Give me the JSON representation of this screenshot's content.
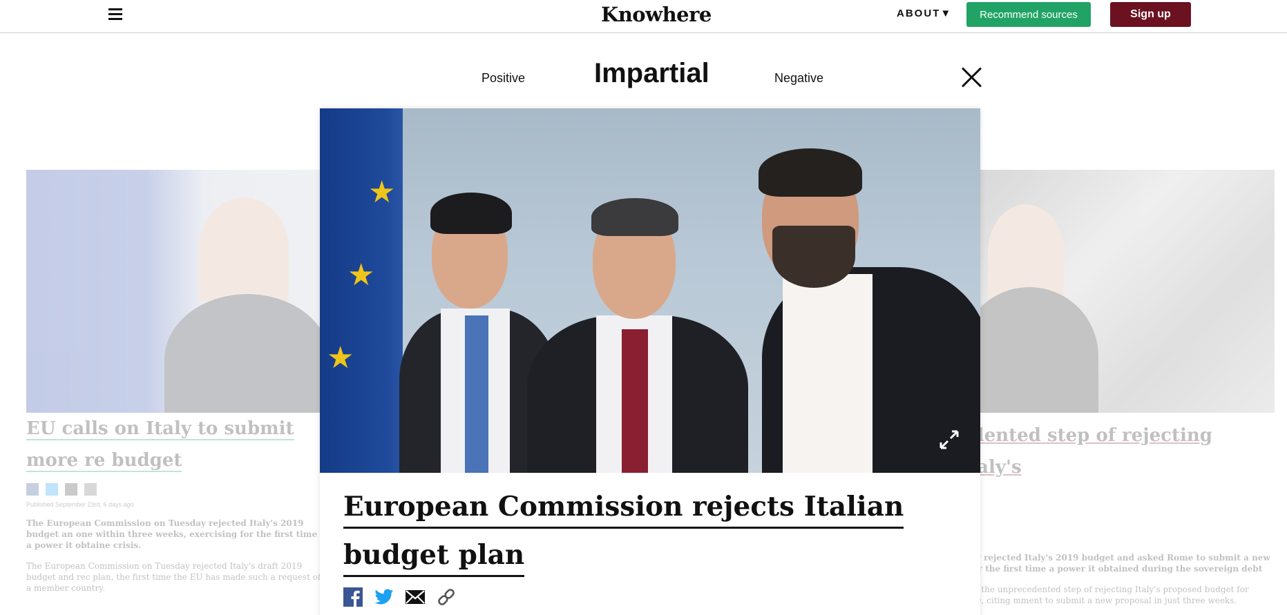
{
  "nav": {
    "logo": "Knowhere",
    "about": "ABOUT▼",
    "recommend": "Recommend sources",
    "signup": "Sign up"
  },
  "tabs": {
    "positive": "Positive",
    "impartial": "Impartial",
    "negative": "Negative"
  },
  "background_left": {
    "title": "EU calls on Italy to submit more re budget",
    "meta": "Published September 23rd, 6 days ago",
    "para1": "The European Commission on Tuesday rejected Italy's 2019 budget an one within three weeks, exercising for the first time a power it obtaine crisis.",
    "para2": "The European Commission on Tuesday rejected Italy's draft 2019 budget and rec plan, the first time the EU has made such a request of a member country."
  },
  "background_right": {
    "title": "edented step of rejecting Italy's",
    "para1": "sday rejected Italy's 2019 budget and asked Rome to submit a new g for the first time a power it obtained during the sovereign debt",
    "para2": "took the unprecedented step of rejecting Italy's proposed budget for 2019, citing mment to submit a new proposal in just three weeks."
  },
  "article": {
    "title": "European Commission rejects Italian budget plan",
    "share_icons": [
      "facebook-icon",
      "twitter-icon",
      "email-icon",
      "link-icon"
    ]
  },
  "colors": {
    "recommend_button": "#21a366",
    "signup_button": "#6b1120",
    "facebook": "#3a5795",
    "twitter": "#1da1f2"
  }
}
